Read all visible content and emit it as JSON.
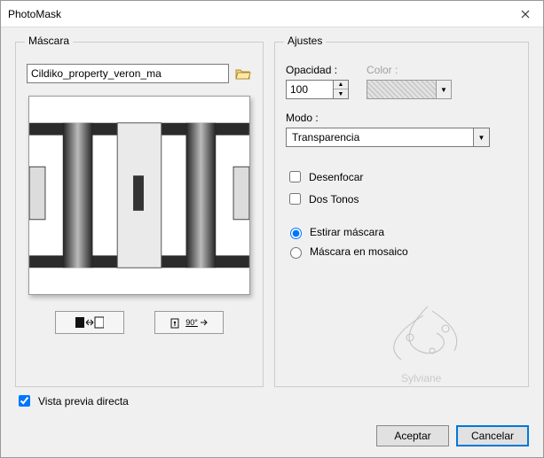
{
  "window": {
    "title": "PhotoMask"
  },
  "mask": {
    "legend": "Máscara",
    "filename": "Cildiko_property_veron_ma"
  },
  "adjust": {
    "legend": "Ajustes",
    "opacity_label": "Opacidad :",
    "opacity_value": "100",
    "color_label": "Color :",
    "mode_label": "Modo :",
    "mode_value": "Transparencia",
    "blur_label": "Desenfocar",
    "twotone_label": "Dos Tonos",
    "stretch_label": "Estirar máscara",
    "tile_label": "Máscara en mosaico"
  },
  "preview_direct": "Vista previa directa",
  "buttons": {
    "ok": "Aceptar",
    "cancel": "Cancelar"
  },
  "watermark": "Sylviane",
  "icons": {
    "rotate_deg": "90°"
  }
}
